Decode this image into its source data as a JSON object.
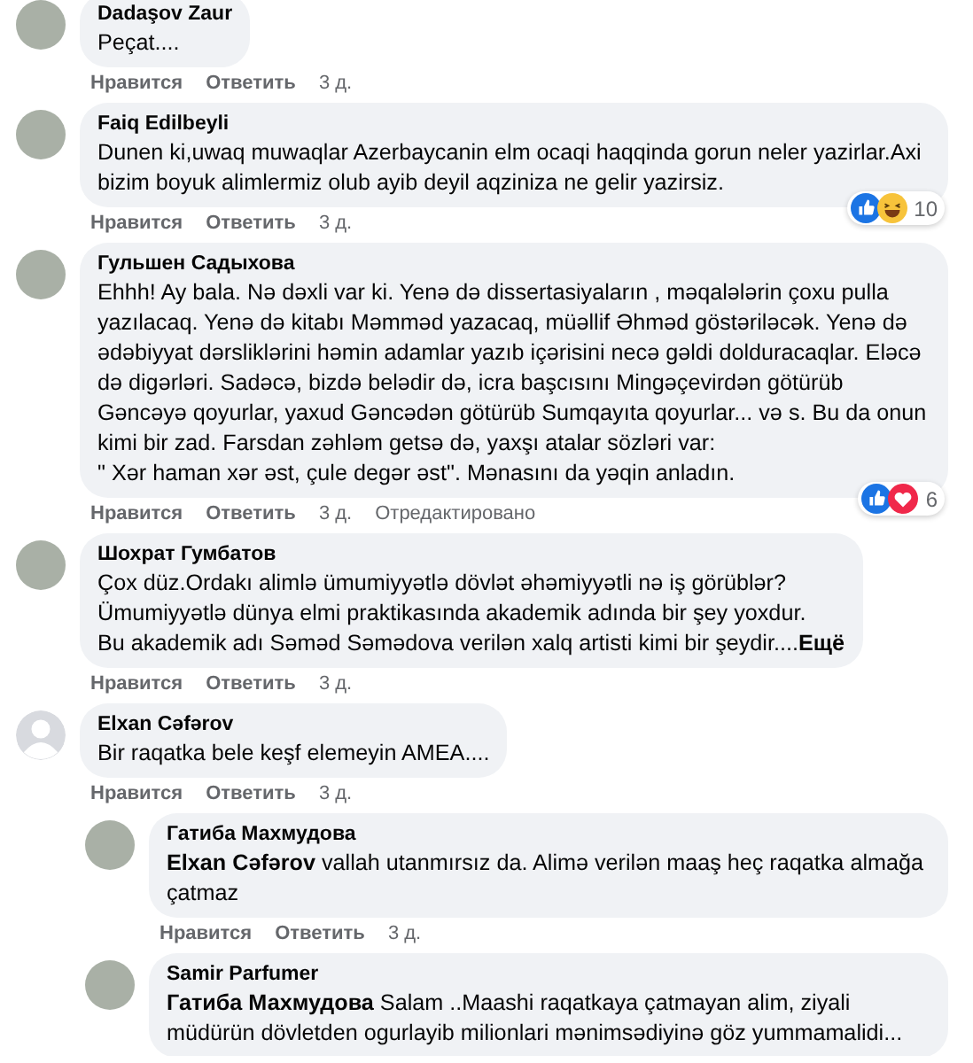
{
  "comments": [
    {
      "author": "Dadaşov Zaur",
      "avatar": {
        "kind": "photo"
      },
      "text": "Peçat....",
      "actions": [
        "Нравится",
        "Ответить"
      ],
      "time": "3 д."
    },
    {
      "author": "Faiq Edilbeyli",
      "avatar": {
        "kind": "photo"
      },
      "text": "Dunen ki,uwaq muwaqlar Azerbaycanin elm ocaqi haqqinda gorun neler yazirlar.Axi bizim boyuk alimlermiz olub ayib deyil aqziniza ne gelir yazirsiz.",
      "reactions": {
        "icons": [
          {
            "kind": "like"
          },
          {
            "kind": "haha"
          }
        ],
        "count": "10"
      },
      "actions": [
        "Нравится",
        "Ответить"
      ],
      "time": "3 д."
    },
    {
      "author": "Гульшен Садыхова",
      "avatar": {
        "kind": "photo"
      },
      "text": "Ehhh! Ay bala. Nə dəxli var ki. Yenə də dissertasiyaların , məqalələrin çoxu pulla yazılacaq. Yenə də kitabı Məmməd yazacaq, müəllif Əhməd göstəriləcək. Yenə də ədəbiyyat dərsliklərini həmin adamlar yazıb içərisini necə gəldi dolduracaqlar. Eləcə də digərləri. Sadəcə, bizdə belədir də, icra başcısını Mingəçevirdən götürüb Gəncəyə qoyurlar, yaxud Gəncədən götürüb Sumqayıta qoyurlar... və s. Bu da onun kimi bir zad. Farsdan zəhləm getsə də, yaxşı atalar sözləri var:\n\" Xər haman xər əst, çule degər əst\". Mənasını da yəqin anladın.",
      "reactions": {
        "icons": [
          {
            "kind": "like"
          },
          {
            "kind": "love"
          }
        ],
        "count": "6"
      },
      "actions": [
        "Нравится",
        "Ответить"
      ],
      "time": "3 д.",
      "edited": "Отредактировано"
    },
    {
      "author": "Шохрат Гумбатов",
      "avatar": {
        "kind": "photo"
      },
      "text": "Çox düz.Ordakı alimlə ümumiyyətlə dövlət əhəmiyyətli nə iş görüblər?\nÜmumiyyətlə dünya elmi praktikasında akademik adında bir şey yoxdur.\nBu akademik adı Səməd Səmədova verilən xalq artisti kimi bir şeydir....",
      "more": "Ещё",
      "actions": [
        "Нравится",
        "Ответить"
      ],
      "time": "3 д."
    },
    {
      "author": "Elxan Cəfərov",
      "avatar": {
        "kind": "default"
      },
      "text": "Bir raqatka bele keşf elemeyin AMEA....",
      "actions": [
        "Нравится",
        "Ответить"
      ],
      "time": "3 д.",
      "children": [
        {
          "author": "Гатиба Махмудова",
          "avatar": {
            "kind": "photo"
          },
          "text": "**Elxan Cəfərov** vallah utanmırsız da. Alimə verilən maaş heç raqatka almağa çatmaz",
          "actions": [
            "Нравится",
            "Ответить"
          ],
          "time": "3 д."
        },
        {
          "author": "Samir Parfumer",
          "avatar": {
            "kind": "photo"
          },
          "text": "**Гатиба Махмудова** Salam ..Maashi raqatkaya çatmayan alim, ziyali müdürün dövletden ogurlayib milionlari mənimsədiyinə göz yummamalidi..."
        }
      ]
    }
  ]
}
